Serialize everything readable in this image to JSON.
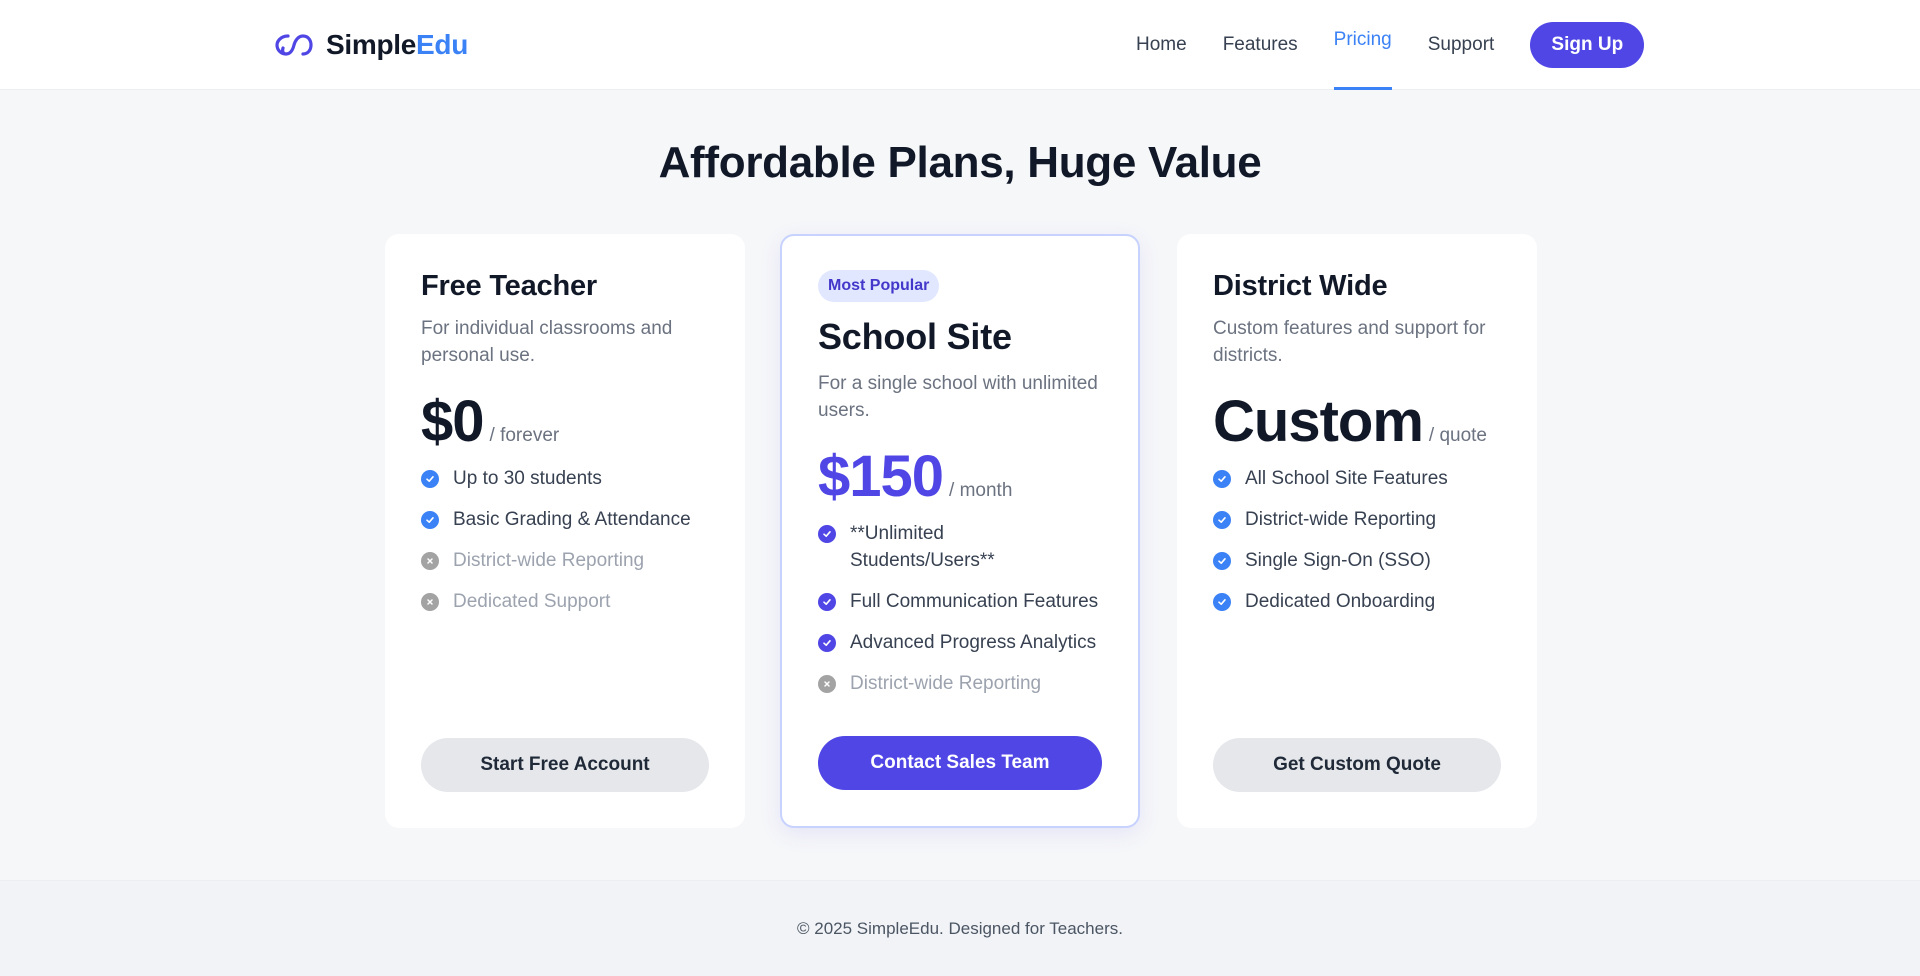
{
  "header": {
    "brand_main": "Simple",
    "brand_accent": "Edu",
    "nav": [
      {
        "label": "Home"
      },
      {
        "label": "Features"
      },
      {
        "label": "Pricing"
      },
      {
        "label": "Support"
      }
    ],
    "active_nav": "Pricing",
    "signup_label": "Sign Up"
  },
  "main": {
    "title": "Affordable Plans, Huge Value",
    "plans": [
      {
        "name": "Free Teacher",
        "description": "For individual classrooms and personal use.",
        "price": "$0",
        "period": "/ forever",
        "features": [
          {
            "text": "Up to 30 students",
            "included": true
          },
          {
            "text": "Basic Grading & Attendance",
            "included": true
          },
          {
            "text": "District-wide Reporting",
            "included": false
          },
          {
            "text": "Dedicated Support",
            "included": false
          }
        ],
        "cta": "Start Free Account"
      },
      {
        "badge": "Most Popular",
        "name": "School Site",
        "description": "For a single school with unlimited users.",
        "price": "$150",
        "period": "/ month",
        "features": [
          {
            "text": "**Unlimited Students/Users**",
            "included": true
          },
          {
            "text": "Full Communication Features",
            "included": true
          },
          {
            "text": "Advanced Progress Analytics",
            "included": true
          },
          {
            "text": "District-wide Reporting",
            "included": false
          }
        ],
        "cta": "Contact Sales Team"
      },
      {
        "name": "District Wide",
        "description": "Custom features and support for districts.",
        "price": "Custom",
        "period": "/ quote",
        "features": [
          {
            "text": "All School Site Features",
            "included": true
          },
          {
            "text": "District-wide Reporting",
            "included": true
          },
          {
            "text": "Single Sign-On (SSO)",
            "included": true
          },
          {
            "text": "Dedicated Onboarding",
            "included": true
          }
        ],
        "cta": "Get Custom Quote"
      }
    ]
  },
  "footer": {
    "text": "© 2025 SimpleEdu. Designed for Teachers."
  },
  "colors": {
    "primary": "#4f46e5",
    "accent_blue": "#3b82f6",
    "text_dark": "#111827",
    "muted": "#6b7280"
  },
  "icons": {
    "logo": "interlocking-loops-logo-icon",
    "included": "check-circle-icon",
    "excluded": "x-circle-icon"
  }
}
